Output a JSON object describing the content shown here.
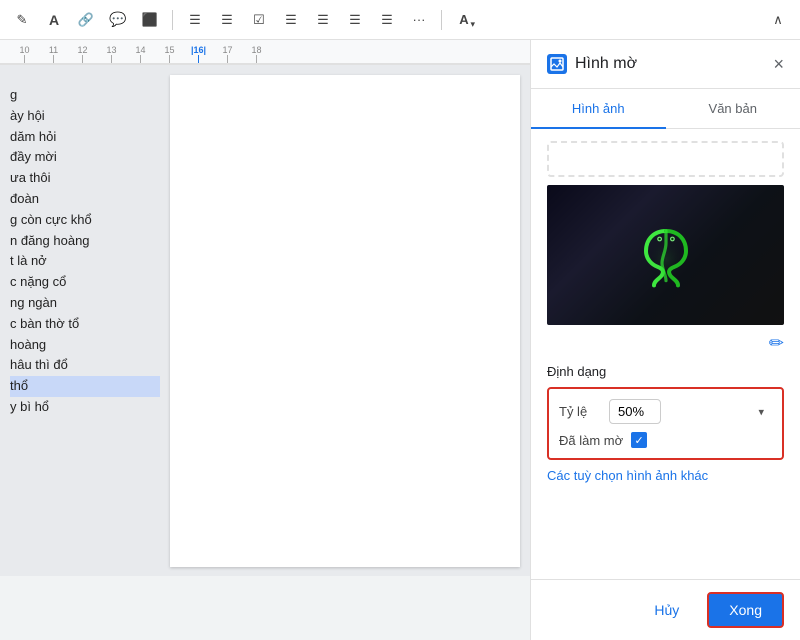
{
  "toolbar": {
    "items": [
      "✏️",
      "A",
      "🔗",
      "💬",
      "🖼️",
      "|",
      "≡",
      "≡",
      "☑",
      "≡",
      "≡",
      "≡",
      "≡",
      "≡",
      "...",
      "|",
      "A~"
    ]
  },
  "ruler": {
    "marks": [
      "10",
      "11",
      "12",
      "13",
      "14",
      "15",
      "|16|",
      "17",
      "18"
    ]
  },
  "document": {
    "lines": [
      {
        "text": "g",
        "selected": false
      },
      {
        "text": "ày hội",
        "selected": false
      },
      {
        "text": "dăm hỏi",
        "selected": false
      },
      {
        "text": " đầy mời",
        "selected": false
      },
      {
        "text": "ưa thôi",
        "selected": false
      },
      {
        "text": "đoàn",
        "selected": false
      },
      {
        "text": "g còn cực khổ",
        "selected": false
      },
      {
        "text": "n đăng hoàng",
        "selected": false
      },
      {
        "text": "t là nở",
        "selected": false
      },
      {
        "text": "c nặng cổ",
        "selected": false
      },
      {
        "text": "ng ngàn",
        "selected": false
      },
      {
        "text": "c bàn thờ tổ",
        "selected": false
      },
      {
        "text": "hoàng",
        "selected": false
      },
      {
        "text": "hâu thì đổ",
        "selected": false
      },
      {
        "text": "thổ",
        "selected": true
      },
      {
        "text": "y bì hổ",
        "selected": false
      }
    ]
  },
  "panel": {
    "icon": "🖼",
    "title": "Hình mờ",
    "close_label": "×",
    "tabs": [
      {
        "label": "Hình ảnh",
        "active": true
      },
      {
        "label": "Văn bản",
        "active": false
      }
    ],
    "image_alt": "Razer snake logo on dark background",
    "edit_icon": "✏",
    "format": {
      "section_label": "Định dạng",
      "ratio_label": "Tỷ lệ",
      "ratio_value": "50%",
      "blur_label": "Đã làm mờ",
      "blur_checked": true,
      "options_link": "Các tuỳ chọn hình ảnh khác"
    },
    "buttons": {
      "cancel": "Hủy",
      "done": "Xong"
    }
  }
}
